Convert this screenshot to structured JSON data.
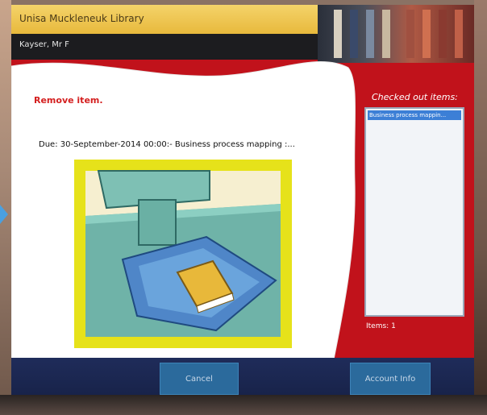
{
  "header": {
    "library_name": "Unisa Muckleneuk Library",
    "patron_name": "Kayser, Mr F"
  },
  "main": {
    "instruction": "Remove item.",
    "due_line": "Due: 30-September-2014 00:00:- Business process mapping :..."
  },
  "checked_out": {
    "title": "Checked out items:",
    "items": [
      "Business process mappin..."
    ],
    "count_text": "Items: 1"
  },
  "buttons": {
    "cancel": "Cancel",
    "account_info": "Account Info"
  },
  "colors": {
    "screen_red": "#c1121b",
    "header_gold": "#e8b93c",
    "instruction_red": "#d41f1f",
    "selection_blue": "#3c7fd6",
    "button_blue": "#2b6a9c"
  }
}
